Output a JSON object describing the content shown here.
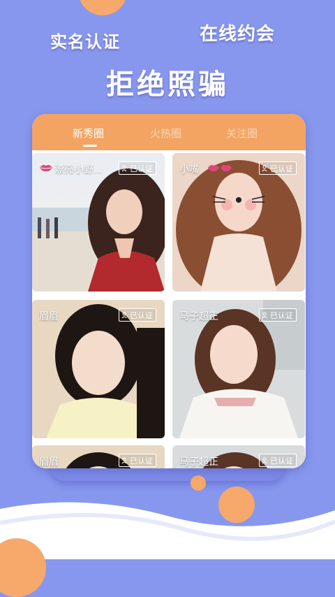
{
  "slogans": {
    "realname": "实名认证",
    "online_date": "在线约会",
    "no_fraud": "拒绝照骗"
  },
  "tabs": [
    {
      "label": "新秀圈",
      "active": true
    },
    {
      "label": "火热圈",
      "active": false
    },
    {
      "label": "关注圈",
      "active": false
    }
  ],
  "cards": [
    {
      "name": "漂亮小野...",
      "badge": "已认证",
      "icon": "lips-icon"
    },
    {
      "name": "小嘴",
      "badge": "已认证",
      "icon": "lips-icon"
    },
    {
      "name": "眉眉",
      "badge": "已认证"
    },
    {
      "name": "马子超正",
      "badge": "已认证"
    },
    {
      "name": "眉眉",
      "badge": "已认证"
    },
    {
      "name": "马子超正",
      "badge": "已认证"
    }
  ],
  "colors": {
    "background": "#8897EE",
    "accent_orange": "#F3A463",
    "white": "#FFFFFF"
  }
}
